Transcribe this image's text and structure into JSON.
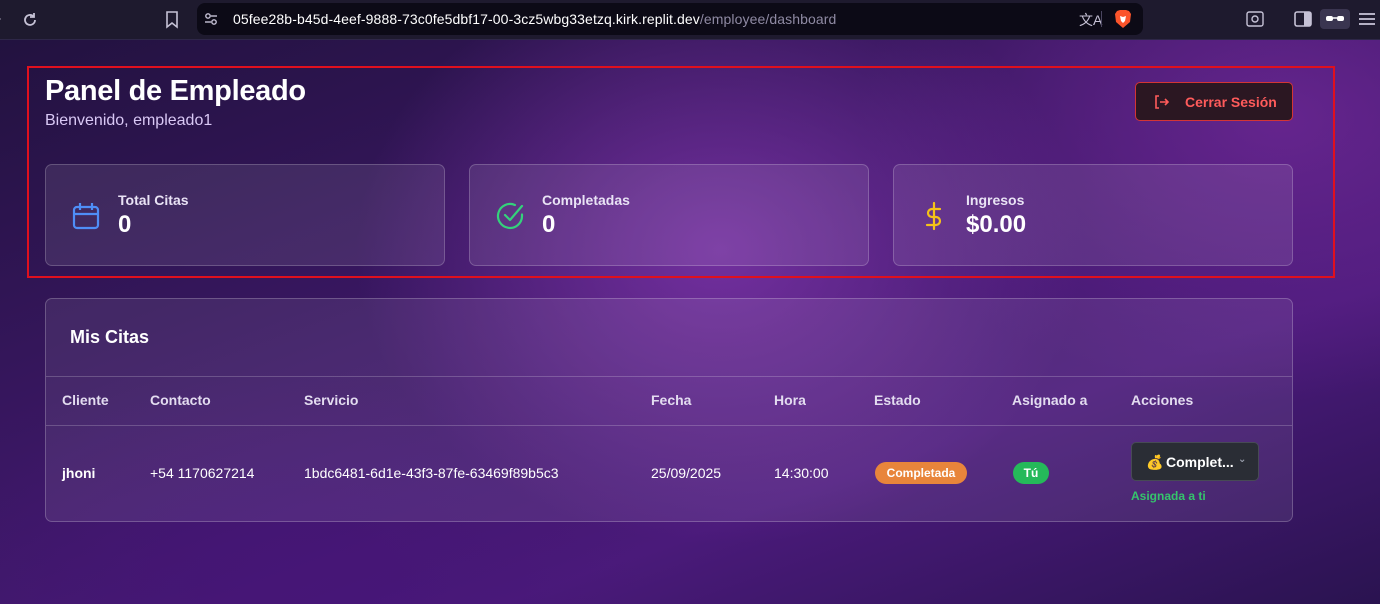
{
  "browser": {
    "url_host": "05fee28b-b45d-4eef-9888-73c0fe5dbf17-00-3cz5wbg33etzq.kirk.replit.dev",
    "url_path": "/employee/dashboard"
  },
  "header": {
    "title": "Panel de Empleado",
    "subtitle": "Bienvenido, empleado1",
    "logout_label": "Cerrar Sesión"
  },
  "stats": [
    {
      "label": "Total Citas",
      "value": "0",
      "icon": "calendar-icon",
      "color": "#4f8ef7"
    },
    {
      "label": "Completadas",
      "value": "0",
      "icon": "check-circle-icon",
      "color": "#34d27b"
    },
    {
      "label": "Ingresos",
      "value": "$0.00",
      "icon": "dollar-icon",
      "color": "#f5c218"
    }
  ],
  "appointments": {
    "title": "Mis Citas",
    "columns": [
      "Cliente",
      "Contacto",
      "Servicio",
      "Fecha",
      "Hora",
      "Estado",
      "Asignado a",
      "Acciones"
    ],
    "rows": [
      {
        "cliente": "jhoni",
        "contacto": "+54 1170627214",
        "servicio": "1bdc6481-6d1e-43f3-87fe-63469f89b5c3",
        "fecha": "25/09/2025",
        "hora": "14:30:00",
        "estado": "Completada",
        "asignado": "Tú",
        "accion_emoji": "💰",
        "accion_select": "Complet...",
        "accion_nota": "Asignada a ti"
      }
    ]
  },
  "colors": {
    "status_completed": "#e8853b",
    "assigned_you": "#25b95a",
    "logout_accent": "#ff5b5b"
  }
}
